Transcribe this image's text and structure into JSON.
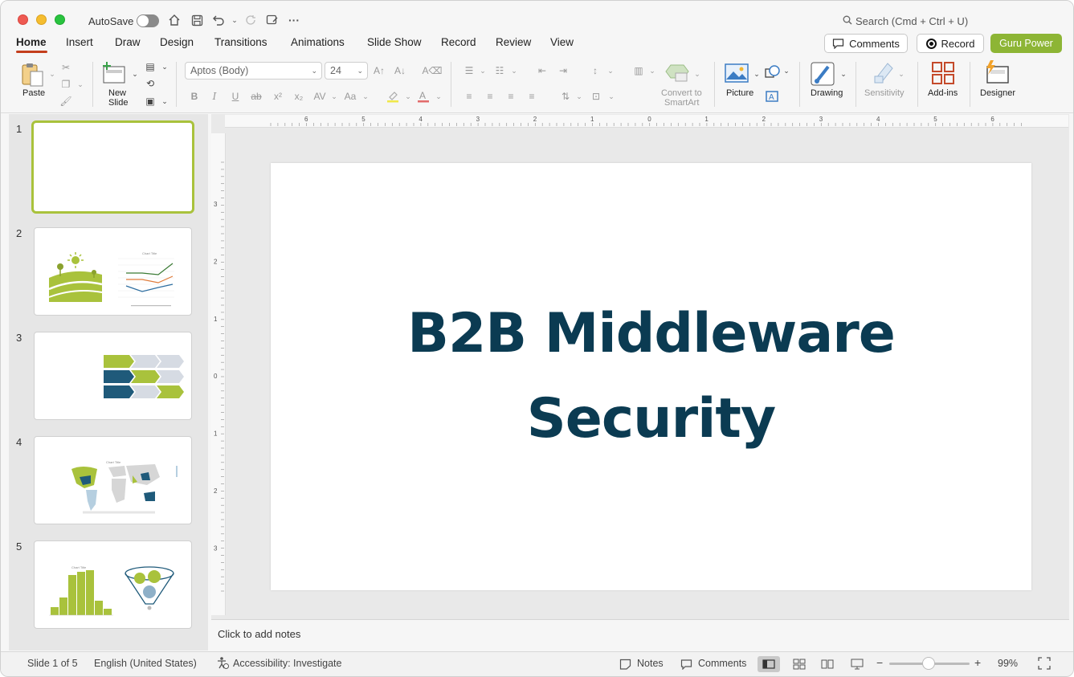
{
  "titlebar": {
    "autosave_label": "AutoSave",
    "search_placeholder": "Search (Cmd + Ctrl + U)"
  },
  "tabs": [
    {
      "label": "Home"
    },
    {
      "label": "Insert"
    },
    {
      "label": "Draw"
    },
    {
      "label": "Design"
    },
    {
      "label": "Transitions"
    },
    {
      "label": "Animations"
    },
    {
      "label": "Slide Show"
    },
    {
      "label": "Record"
    },
    {
      "label": "Review"
    },
    {
      "label": "View"
    }
  ],
  "header_buttons": {
    "comments": "Comments",
    "record": "Record",
    "guru": "Guru Power"
  },
  "ribbon": {
    "paste": "Paste",
    "new_slide_1": "New",
    "new_slide_2": "Slide",
    "font_name": "Aptos (Body)",
    "font_size": "24",
    "smartart_1": "Convert to",
    "smartart_2": "SmartArt",
    "picture": "Picture",
    "drawing": "Drawing",
    "sensitivity": "Sensitivity",
    "addins": "Add-ins",
    "designer": "Designer"
  },
  "slides": [
    {
      "number": "1"
    },
    {
      "number": "2"
    },
    {
      "number": "3"
    },
    {
      "number": "4"
    },
    {
      "number": "5"
    }
  ],
  "thumb_labels": {
    "chart_title": "Chart Title"
  },
  "slide": {
    "title_line1": "B2B Middleware",
    "title_line2": "Security"
  },
  "notes_placeholder": "Click to add notes",
  "status": {
    "slide_count": "Slide 1 of 5",
    "language": "English (United States)",
    "accessibility": "Accessibility: Investigate",
    "notes": "Notes",
    "comments": "Comments",
    "zoom_minus": "−",
    "zoom_plus": "+",
    "zoom": "99%"
  },
  "ruler": {
    "h_ticks": [
      "6",
      "5",
      "4",
      "3",
      "2",
      "1",
      "0",
      "1",
      "2",
      "3",
      "4",
      "5",
      "6"
    ],
    "v_ticks": [
      "3",
      "2",
      "1",
      "0",
      "1",
      "2",
      "3"
    ]
  },
  "colors": {
    "accent_green": "#8db535",
    "title_navy": "#0b3b52",
    "tab_underline": "#c43e1c"
  }
}
